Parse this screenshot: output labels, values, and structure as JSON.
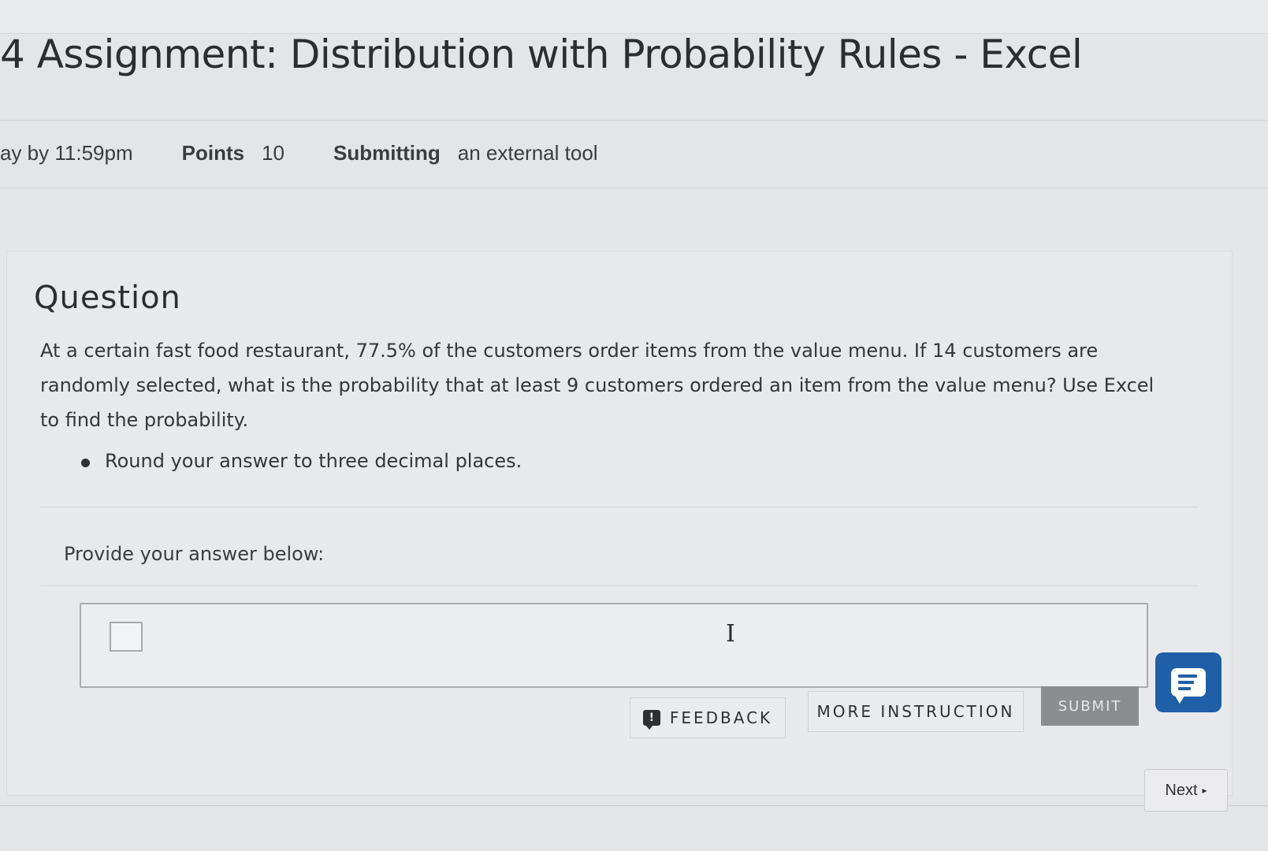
{
  "header": {
    "title": "4 Assignment: Distribution with Probability Rules - Excel"
  },
  "meta": {
    "due_text": "ay by 11:59pm",
    "points_label": "Points",
    "points_value": "10",
    "submitting_label": "Submitting",
    "submitting_value": "an external tool"
  },
  "question": {
    "heading": "Question",
    "text": "At a certain fast food restaurant, 77.5% of the customers order items from the value menu. If 14 customers are randomly selected, what is the probability that at least 9 customers ordered an item from the value menu? Use Excel to find the probability.",
    "bullets": [
      "Round your answer to three decimal places."
    ],
    "answer_label": "Provide your answer below:"
  },
  "answer": {
    "value": ""
  },
  "buttons": {
    "feedback": "FEEDBACK",
    "more_instruction": "MORE INSTRUCTION",
    "submit": "SUBMIT",
    "next": "Next"
  },
  "icons": {
    "feedback": "feedback-icon",
    "chat": "chat-icon",
    "cursor": "text-cursor-icon",
    "next_arrow": "next-arrow-icon"
  },
  "colors": {
    "chat_button": "#1f5fa8",
    "submit_button": "#8b8d90"
  }
}
